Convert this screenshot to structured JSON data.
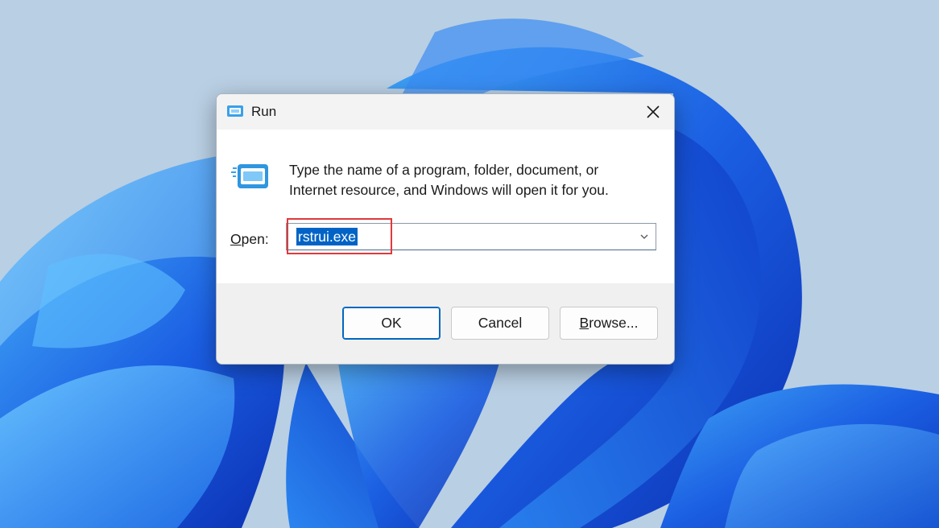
{
  "dialog": {
    "title": "Run",
    "description_line1": "Type the name of a program, folder, document, or",
    "description_line2": "Internet resource, and Windows will open it for you.",
    "open_label_accel": "O",
    "open_label_rest": "pen:",
    "open_value": "rstrui.exe",
    "buttons": {
      "ok": "OK",
      "cancel": "Cancel",
      "browse_accel": "B",
      "browse_rest": "rowse..."
    }
  },
  "icons": {
    "title": "run-icon",
    "main": "run-icon",
    "close": "close-icon",
    "dropdown": "chevron-down-icon"
  },
  "colors": {
    "selection": "#0063c5",
    "highlight_box": "#e0393b",
    "wallpaper_blue": "#1e5ee6",
    "desktop_bg": "#b9cfe3"
  }
}
